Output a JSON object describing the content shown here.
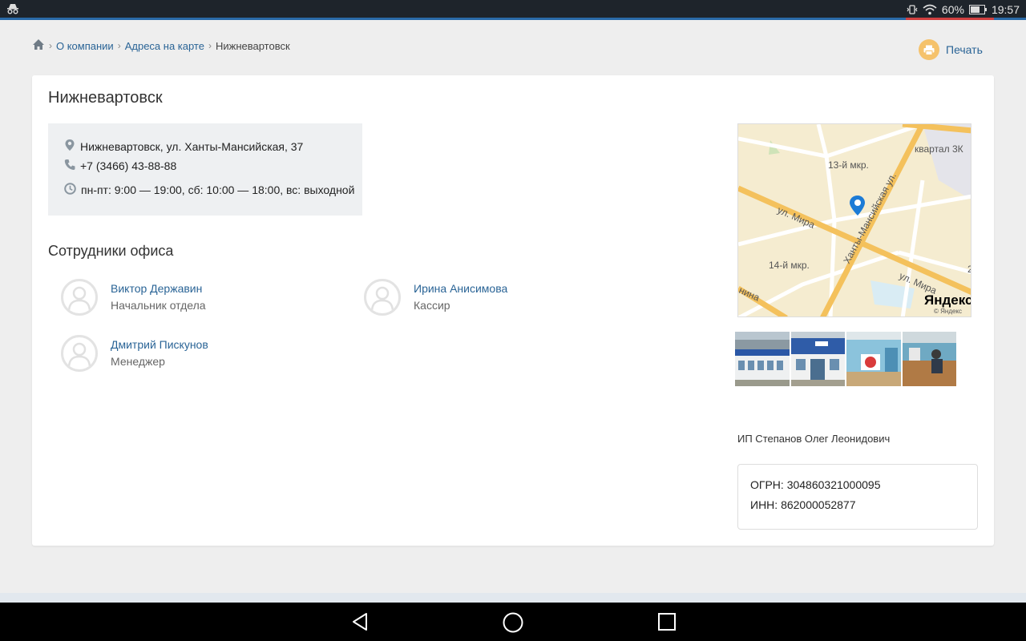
{
  "status_bar": {
    "battery": "60%",
    "time": "19:57"
  },
  "breadcrumb": {
    "items": [
      "О компании",
      "Адреса на карте"
    ],
    "current": "Нижневартовск"
  },
  "print_label": "Печать",
  "office": {
    "title": "Нижневартовск",
    "address": "Нижневартовск, ул. Ханты-Мансийская, 37",
    "phone": "+7 (3466) 43-88-88",
    "hours": "пн-пт: 9:00 — 19:00, сб: 10:00 — 18:00, вс: выходной"
  },
  "staff": {
    "title": "Сотрудники офиса",
    "members": [
      {
        "name": "Виктор Державин",
        "role": "Начальник отдела"
      },
      {
        "name": "Ирина Анисимова",
        "role": "Кассир"
      },
      {
        "name": "Дмитрий Пискунов",
        "role": "Менеджер"
      }
    ]
  },
  "map": {
    "labels": [
      "13-й мкр.",
      "квартал 3К",
      "ул. Мира",
      "Ханты-Мансийская ул.",
      "14-й мкр.",
      "ул. Мира",
      "нина",
      "2"
    ],
    "brand": "Яндекс",
    "copyright": "© Яндекс"
  },
  "legal": {
    "company": "ИП Степанов Олег Леонидович",
    "ogrn": "ОГРН: 304860321000095",
    "inn": "ИНН: 862000052877"
  },
  "colors": {
    "link": "#2a6496",
    "print_icon_bg": "#f5c26b",
    "map_bg": "#f5ecd0",
    "road_major": "#f4c15c"
  }
}
